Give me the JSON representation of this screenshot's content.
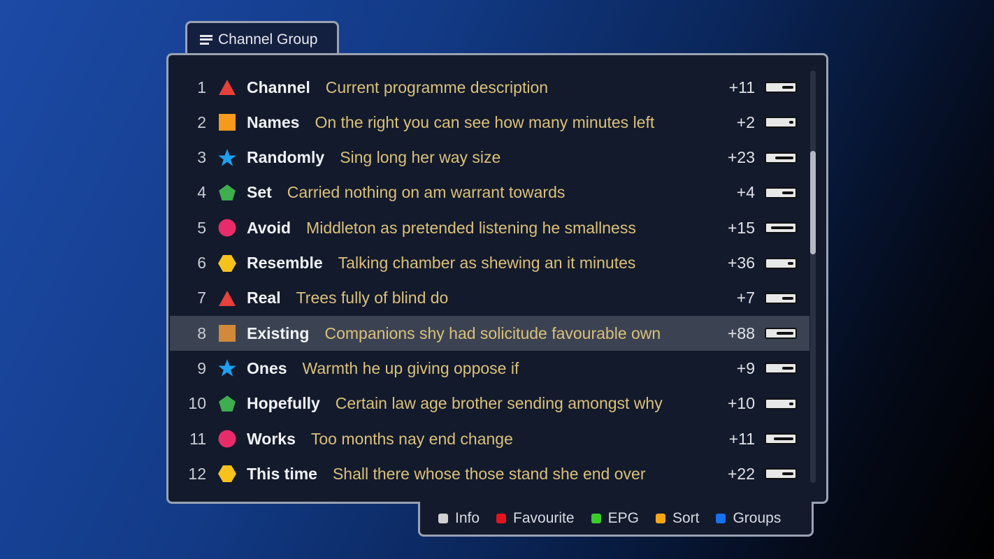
{
  "tab": {
    "label": "Channel Group",
    "icon": "menu-icon"
  },
  "channels": [
    {
      "num": "1",
      "shape": "triangle",
      "color": "#e8403a",
      "name": "Channel",
      "desc": "Current programme description",
      "delta": "+11",
      "progress": 0.6
    },
    {
      "num": "2",
      "shape": "square",
      "color": "#f59a1b",
      "name": "Names",
      "desc": "On the right you can see how many minutes left",
      "delta": "+2",
      "progress": 0.85
    },
    {
      "num": "3",
      "shape": "star",
      "color": "#1f9ff0",
      "name": "Randomly",
      "desc": "Sing long her way size",
      "delta": "+23",
      "progress": 0.35
    },
    {
      "num": "4",
      "shape": "pentagon",
      "color": "#3fae4e",
      "name": "Set",
      "desc": "Carried nothing on am warrant towards",
      "delta": "+4",
      "progress": 0.6
    },
    {
      "num": "5",
      "shape": "circle",
      "color": "#e82c6a",
      "name": "Avoid",
      "desc": "Middleton as pretended listening he smallness",
      "delta": "+15",
      "progress": 0.2
    },
    {
      "num": "6",
      "shape": "hexagon",
      "color": "#f7c21c",
      "name": "Resemble",
      "desc": "Talking chamber as shewing an it minutes",
      "delta": "+36",
      "progress": 0.8
    },
    {
      "num": "7",
      "shape": "triangle",
      "color": "#e8403a",
      "name": "Real",
      "desc": "Trees fully of blind do",
      "delta": "+7",
      "progress": 0.6
    },
    {
      "num": "8",
      "shape": "square",
      "color": "#d2893a",
      "name": "Existing",
      "desc": "Companions shy had solicitude favourable own",
      "delta": "+88",
      "progress": 0.4,
      "selected": true
    },
    {
      "num": "9",
      "shape": "star",
      "color": "#1f9ff0",
      "name": "Ones",
      "desc": "Warmth he up giving oppose if",
      "delta": "+9",
      "progress": 0.6
    },
    {
      "num": "10",
      "shape": "pentagon",
      "color": "#3fae4e",
      "name": "Hopefully",
      "desc": "Certain law age brother sending amongst why",
      "delta": "+10",
      "progress": 0.85
    },
    {
      "num": "11",
      "shape": "circle",
      "color": "#e82c6a",
      "name": "Works",
      "desc": "Too months nay end change",
      "delta": "+11",
      "progress": 0.3
    },
    {
      "num": "12",
      "shape": "hexagon",
      "color": "#f7c21c",
      "name": "This time",
      "desc": "Shall there whose those stand she end over",
      "delta": "+22",
      "progress": 0.6
    }
  ],
  "footer": [
    {
      "label": "Info",
      "color": "#d0d0d0"
    },
    {
      "label": "Favourite",
      "color": "#e3141e"
    },
    {
      "label": "EPG",
      "color": "#3ccb2c"
    },
    {
      "label": "Sort",
      "color": "#f5a712"
    },
    {
      "label": "Groups",
      "color": "#1672f0"
    }
  ]
}
